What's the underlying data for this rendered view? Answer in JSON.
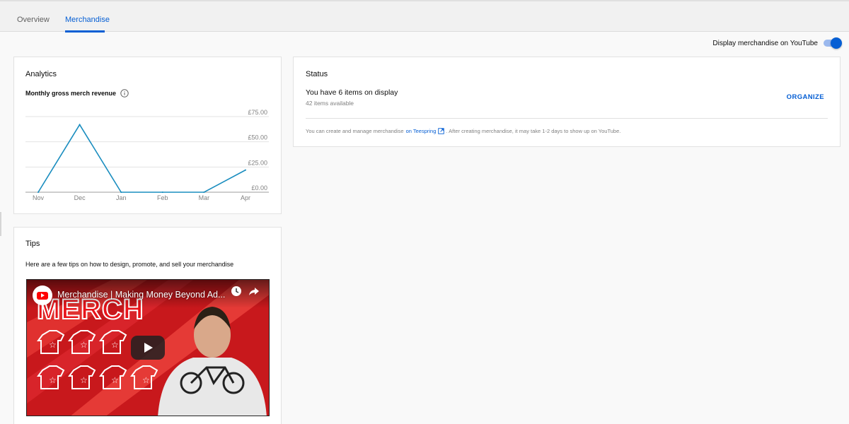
{
  "tabs": [
    {
      "label": "Overview",
      "active": false
    },
    {
      "label": "Merchandise",
      "active": true
    }
  ],
  "display_toggle": {
    "label": "Display merchandise on YouTube",
    "on": true
  },
  "analytics": {
    "title": "Analytics",
    "chart_title": "Monthly gross merch revenue",
    "info_icon": "info-icon"
  },
  "chart_data": {
    "type": "line",
    "categories": [
      "Nov",
      "Dec",
      "Jan",
      "Feb",
      "Mar",
      "Apr"
    ],
    "values": [
      0,
      67,
      0,
      0,
      0,
      22
    ],
    "y_ticks": [
      "£75.00",
      "£50.00",
      "£25.00",
      "£0.00"
    ],
    "ylim": [
      0,
      75
    ],
    "grid": true,
    "color": "#1a8dbf"
  },
  "status": {
    "title": "Status",
    "main": "You have 6 items on display",
    "sub": "42 items available",
    "organize_label": "ORGANIZE",
    "note_before": "You can create and manage merchandise",
    "note_link": "on Teespring",
    "note_after": ". After creating merchandise, it may take 1-2 days to show up on YouTube."
  },
  "tips": {
    "title": "Tips",
    "text": "Here are a few tips on how to design, promote, and sell your merchandise",
    "video": {
      "title": "Merchandise | Making Money Beyond Ad...",
      "overlay_word": "MERCH"
    }
  },
  "colors": {
    "accent": "#065fd4",
    "line": "#1a8dbf",
    "video_red": "#c01818"
  }
}
